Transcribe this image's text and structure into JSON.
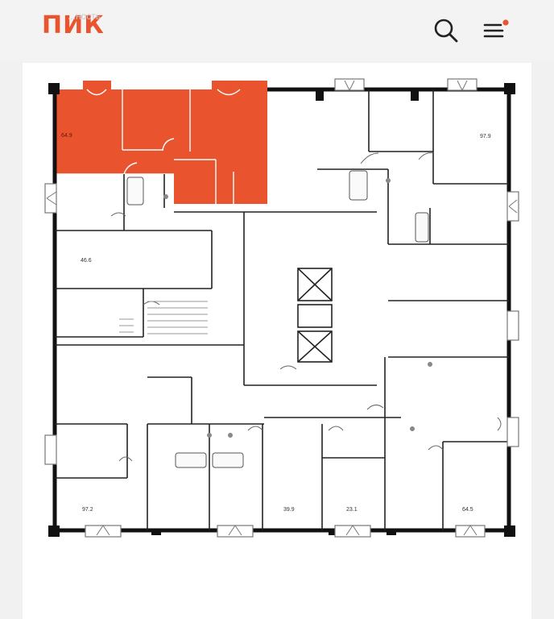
{
  "header": {
    "logo_text": "ПИК",
    "ghost_text": "...ность",
    "search_icon": "search-icon",
    "menu_icon": "hamburger-menu-icon",
    "notification_color": "#e9542f"
  },
  "plan": {
    "highlight_color": "#e9542f",
    "areas": {
      "a64_9": "64.9",
      "a97_9": "97.9",
      "a46_6": "46.6",
      "a97_2": "97.2",
      "a39_9": "39.9",
      "a23_1": "23.1",
      "a64_5": "64.5"
    }
  }
}
